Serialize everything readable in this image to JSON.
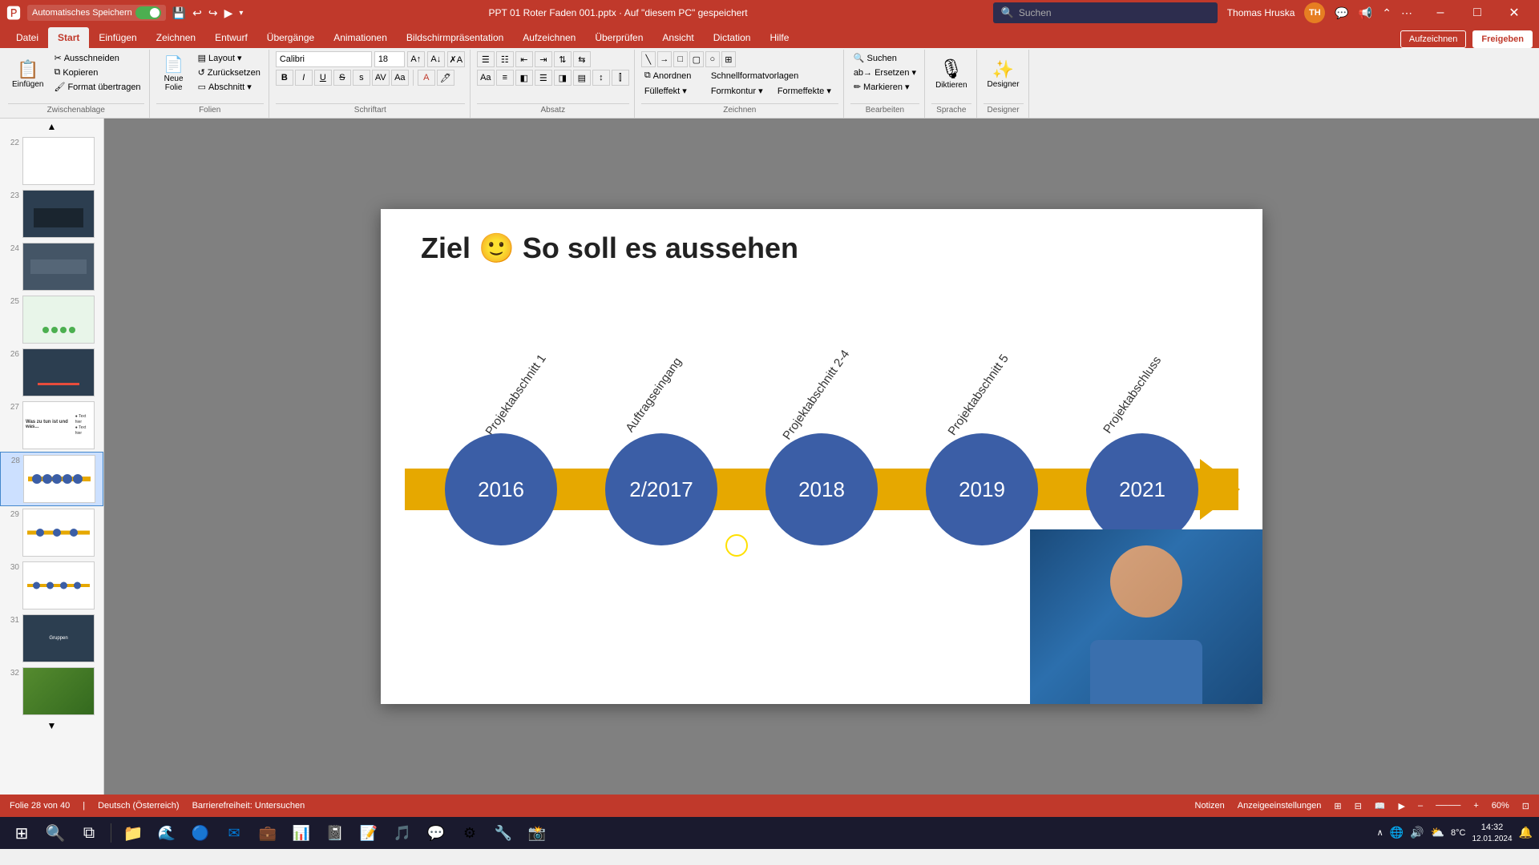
{
  "titlebar": {
    "autosave_label": "Automatisches Speichern",
    "title": "PPT 01 Roter Faden 001.pptx · Auf \"diesem PC\" gespeichert",
    "user": "Thomas Hruska",
    "user_initials": "TH",
    "window_controls": {
      "minimize": "–",
      "maximize": "□",
      "close": "✕"
    }
  },
  "ribbon_tabs": [
    {
      "id": "datei",
      "label": "Datei"
    },
    {
      "id": "start",
      "label": "Start",
      "active": true
    },
    {
      "id": "einfuegen",
      "label": "Einfügen"
    },
    {
      "id": "zeichnen",
      "label": "Zeichnen"
    },
    {
      "id": "entwurf",
      "label": "Entwurf"
    },
    {
      "id": "uebergaenge",
      "label": "Übergänge"
    },
    {
      "id": "animationen",
      "label": "Animationen"
    },
    {
      "id": "bildschirm",
      "label": "Bildschirmpräsentation"
    },
    {
      "id": "aufzeichnen",
      "label": "Aufzeichnen"
    },
    {
      "id": "ueberpruefen",
      "label": "Überprüfen"
    },
    {
      "id": "ansicht",
      "label": "Ansicht"
    },
    {
      "id": "dictation",
      "label": "Dictation"
    },
    {
      "id": "hilfe",
      "label": "Hilfe"
    }
  ],
  "ribbon": {
    "groups": [
      {
        "id": "zwischenablage",
        "label": "Zwischenablage",
        "buttons": [
          {
            "id": "einfuegen-btn",
            "icon": "📋",
            "label": "Einfügen"
          },
          {
            "id": "ausschneiden",
            "icon": "✂",
            "label": "Ausschneiden"
          },
          {
            "id": "kopieren",
            "icon": "⧉",
            "label": "Kopieren"
          },
          {
            "id": "format-uebertragen",
            "icon": "🖌",
            "label": "Format übertragen"
          }
        ]
      },
      {
        "id": "folien",
        "label": "Folien",
        "buttons": [
          {
            "id": "neue-folie",
            "icon": "📄",
            "label": "Neue\nFolie"
          },
          {
            "id": "layout",
            "icon": "▤",
            "label": "Layout"
          },
          {
            "id": "zuruecksetzen",
            "icon": "↺",
            "label": "Zurücksetzen"
          },
          {
            "id": "abschnitt",
            "icon": "▭",
            "label": "Abschnitt"
          }
        ]
      },
      {
        "id": "schriftart",
        "label": "Schriftart",
        "font_name": "Calibri",
        "font_size": "18"
      },
      {
        "id": "absatz",
        "label": "Absatz"
      },
      {
        "id": "zeichnen-group",
        "label": "Zeichnen"
      },
      {
        "id": "bearbeiten",
        "label": "Bearbeiten",
        "buttons": [
          {
            "id": "suchen-btn",
            "icon": "🔍",
            "label": "Suchen"
          },
          {
            "id": "ersetzen-btn",
            "icon": "ab→",
            "label": "Ersetzen"
          },
          {
            "id": "markieren-btn",
            "icon": "✏",
            "label": "Markieren"
          }
        ]
      },
      {
        "id": "sprache",
        "label": "Sprache",
        "buttons": [
          {
            "id": "diktieren-btn",
            "icon": "🎙",
            "label": "Diktieren"
          }
        ]
      },
      {
        "id": "designer-group",
        "label": "Designer",
        "buttons": [
          {
            "id": "designer-btn",
            "icon": "✨",
            "label": "Designer"
          }
        ]
      }
    ],
    "right_buttons": [
      {
        "id": "aufzeichnen-btn",
        "label": "Aufzeichnen"
      },
      {
        "id": "freigeben-btn",
        "label": "Freigeben"
      }
    ]
  },
  "slide_panel": {
    "slides": [
      {
        "num": 22,
        "type": "blank"
      },
      {
        "num": 23,
        "type": "dark-image"
      },
      {
        "num": 24,
        "type": "dark-image2"
      },
      {
        "num": 25,
        "type": "green-dots"
      },
      {
        "num": 26,
        "type": "dark-bar"
      },
      {
        "num": 27,
        "type": "text-slide"
      },
      {
        "num": 28,
        "type": "timeline-active",
        "active": true
      },
      {
        "num": 29,
        "type": "timeline-v2"
      },
      {
        "num": 30,
        "type": "timeline-v3"
      },
      {
        "num": 31,
        "type": "timeline-v4"
      },
      {
        "num": 32,
        "type": "nature"
      }
    ]
  },
  "slide": {
    "title": "Ziel 🙂  So soll es aussehen",
    "timeline": {
      "nodes": [
        {
          "year": "2016",
          "label": "Projektabschnitt 1"
        },
        {
          "year": "2/2017",
          "label": "Auftragseingang"
        },
        {
          "year": "2018",
          "label": "Projektabschnitt 2-4"
        },
        {
          "year": "2019",
          "label": "Projektabschnitt 5"
        },
        {
          "year": "2021",
          "label": "Projektabschluss"
        }
      ]
    }
  },
  "statusbar": {
    "slide_info": "Folie 28 von 40",
    "language": "Deutsch (Österreich)",
    "accessibility": "Barrierefreiheit: Untersuchen",
    "notes": "Notizen",
    "view_settings": "Anzeigeeinstellungen"
  },
  "taskbar": {
    "start_icon": "⊞",
    "search_placeholder": "Suchen",
    "apps": [
      {
        "id": "explorer",
        "icon": "📁"
      },
      {
        "id": "edge",
        "icon": "🌐"
      },
      {
        "id": "chrome",
        "icon": "🔵"
      },
      {
        "id": "mail",
        "icon": "✉"
      },
      {
        "id": "teams",
        "icon": "💼"
      },
      {
        "id": "powerpoint",
        "icon": "📊"
      },
      {
        "id": "onenote",
        "icon": "📓"
      },
      {
        "id": "word",
        "icon": "📝"
      },
      {
        "id": "terminal",
        "icon": "⬛"
      }
    ],
    "system_tray": {
      "weather": "8°C",
      "time": "14:32",
      "date": "12.01.2024"
    }
  }
}
